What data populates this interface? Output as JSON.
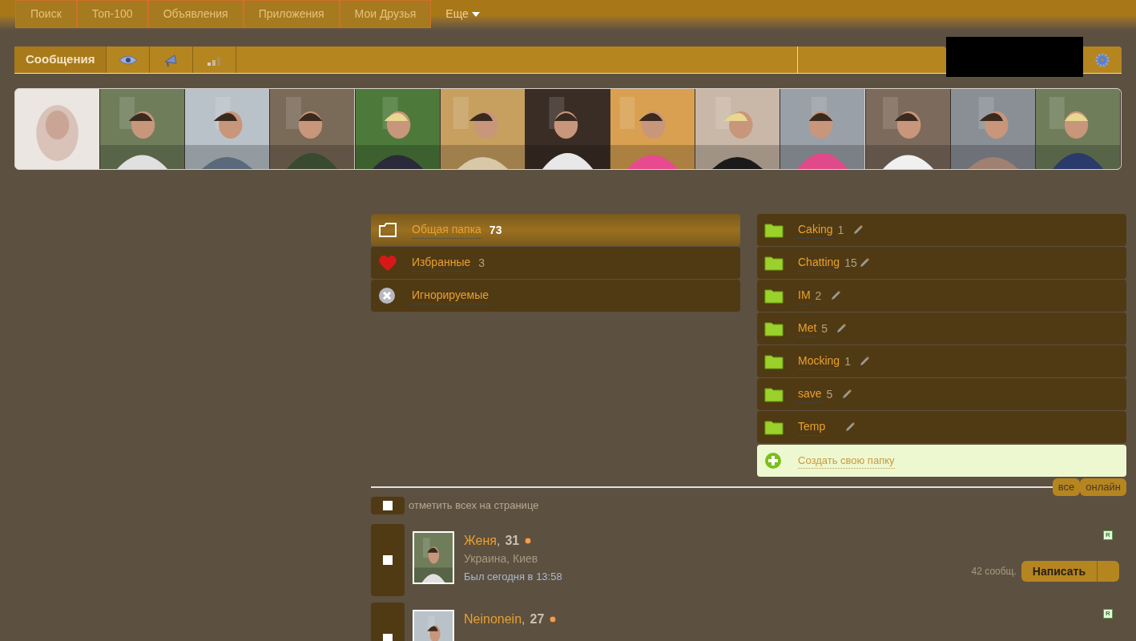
{
  "nav": [
    {
      "label": "Поиск",
      "kind": "tab"
    },
    {
      "label": "Топ-100",
      "kind": "tab"
    },
    {
      "label": "Объявления",
      "kind": "tab"
    },
    {
      "label": "Приложения",
      "kind": "tab"
    },
    {
      "label": "Мои Друзья",
      "kind": "tab"
    },
    {
      "label": "Еще",
      "kind": "menu"
    }
  ],
  "toolbar": {
    "title": "Сообщения"
  },
  "photo_strip": [
    {
      "kind": "blurred"
    },
    {
      "kind": "picture"
    },
    {
      "kind": "picture"
    },
    {
      "kind": "picture"
    },
    {
      "kind": "picture"
    },
    {
      "kind": "picture"
    },
    {
      "kind": "picture"
    },
    {
      "kind": "picture"
    },
    {
      "kind": "picture"
    },
    {
      "kind": "picture"
    },
    {
      "kind": "picture"
    },
    {
      "kind": "picture"
    },
    {
      "kind": "picture"
    }
  ],
  "system_folders": [
    {
      "kind": "folder",
      "label": "Общая папка",
      "count": "73",
      "selected": true
    },
    {
      "kind": "heart",
      "label": "Избранные",
      "count": "3",
      "selected": false
    },
    {
      "kind": "ignore",
      "label": "Игнорируемые",
      "selected": false
    }
  ],
  "custom_folders": [
    {
      "label": "Caking",
      "count": "1"
    },
    {
      "label": "Chatting",
      "count": "15"
    },
    {
      "label": "IM",
      "count": "2"
    },
    {
      "label": "Met",
      "count": "5"
    },
    {
      "label": "Mocking",
      "count": "1"
    },
    {
      "label": "save",
      "count": "5"
    },
    {
      "label": "Temp"
    }
  ],
  "create_folder": "Создать свою папку",
  "filters": [
    "все",
    "онлайн"
  ],
  "select_all": {
    "label": "отметить всех на странице",
    "checked": false
  },
  "messages": [
    {
      "name": "Женя",
      "separator": ",",
      "age": "31",
      "location": "Украина, Киев",
      "last_seen": "Был сегодня в 13:58",
      "badge": "R",
      "count": "42 сообщ.",
      "action": "Написать",
      "checked": false
    },
    {
      "name": "Neinonein",
      "separator": ",",
      "age": "27",
      "badge": "R",
      "checked": false
    }
  ]
}
